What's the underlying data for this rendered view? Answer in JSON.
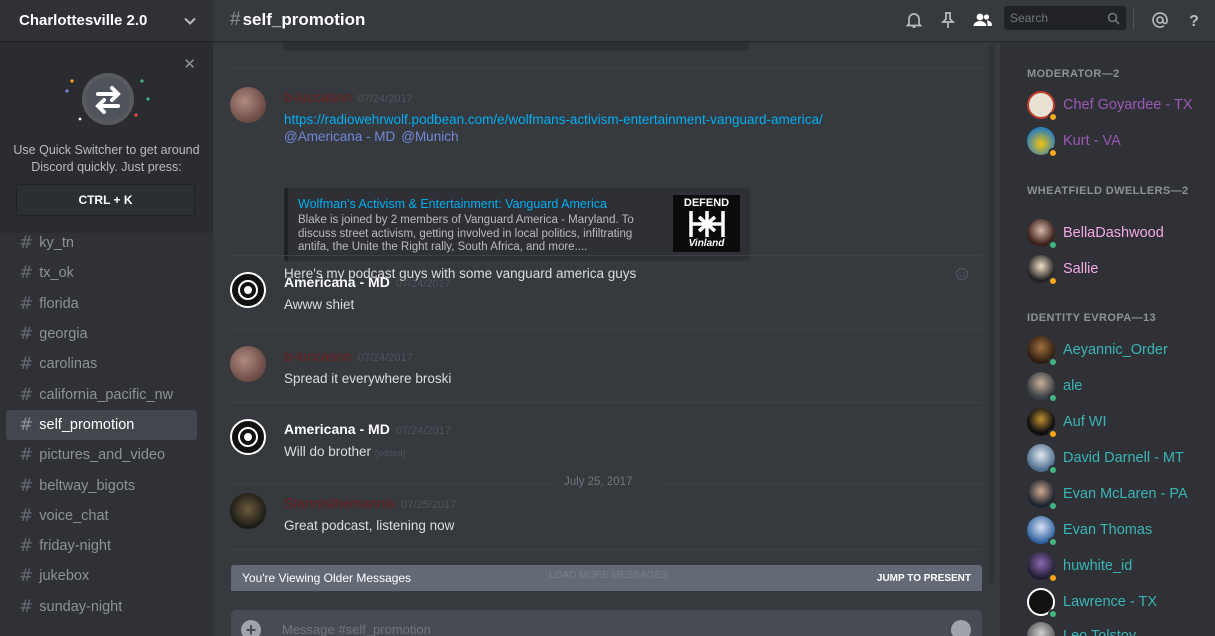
{
  "server": {
    "name": "Charlottesville 2.0"
  },
  "quick_switcher": {
    "line1": "Use Quick Switcher to get around",
    "line2": "Discord quickly. Just press:",
    "key": "CTRL + K"
  },
  "channels": [
    {
      "name": "ky_tn"
    },
    {
      "name": "tx_ok"
    },
    {
      "name": "florida"
    },
    {
      "name": "georgia"
    },
    {
      "name": "carolinas"
    },
    {
      "name": "california_pacific_nw"
    },
    {
      "name": "self_promotion"
    },
    {
      "name": "pictures_and_video"
    },
    {
      "name": "beltway_bigots"
    },
    {
      "name": "voice_chat"
    },
    {
      "name": "friday-night"
    },
    {
      "name": "jukebox"
    },
    {
      "name": "sunday-night"
    }
  ],
  "header": {
    "channel": "self_promotion",
    "search_placeholder": "Search"
  },
  "messages": {
    "m1": {
      "author": "b-luccason",
      "time": "07/24/2017",
      "link": "https://radiowehrwolf.podbean.com/e/wolfmans-activism-entertainment-vanguard-america/",
      "mention1": "@Americana - MD",
      "mention2": "@Munich",
      "embed_title": "Wolfman's Activism & Entertainment: Vanguard America",
      "embed_desc": "Blake is joined by 2 members of Vanguard America - Maryland. To discuss street activism, getting involved in local politics, infiltrating antifa, the Unite the Right rally, South Africa, and more....",
      "embed_img_top": "DEFEND",
      "embed_img_bottom": "Vinland",
      "text": "Here's my podcast guys with some vanguard america guys"
    },
    "m2": {
      "author": "Americana - MD",
      "time": "07/24/2017",
      "text": "Awww shiet"
    },
    "m3": {
      "author": "b-luccason",
      "time": "07/24/2017",
      "text": "Spread it everywhere broski"
    },
    "m4": {
      "author": "Americana - MD",
      "time": "07/24/2017",
      "text": "Will do brother",
      "edited": "(edited)"
    },
    "date_separator": "July 25, 2017",
    "m5": {
      "author": "Stannisthemannis",
      "time": "07/25/2017",
      "text": "Great podcast, listening now"
    }
  },
  "older_bar": {
    "left": "You're Viewing Older Messages",
    "middle": "LOAD MORE MESSAGES",
    "right": "JUMP TO PRESENT"
  },
  "composer": {
    "placeholder": "Message #self_promotion"
  },
  "members": {
    "groups": [
      {
        "title": "MODERATOR—2"
      },
      {
        "title": "WHEATFIELD DWELLERS—2"
      },
      {
        "title": "IDENTITY EVROPA—13"
      }
    ],
    "list": [
      {
        "name": "Chef Goyardee - TX",
        "color": "#9b59b6",
        "status": "#faa61a"
      },
      {
        "name": "Kurt - VA",
        "color": "#9b59b6",
        "status": "#faa61a"
      },
      {
        "name": "BellaDashwood",
        "color": "#f5a9e6",
        "status": "#43b581"
      },
      {
        "name": "Sallie",
        "color": "#f5a9e6",
        "status": "#faa61a"
      },
      {
        "name": "Aeyannic_Order",
        "color": "#3ab5b5",
        "status": "#43b581"
      },
      {
        "name": "ale",
        "color": "#3ab5b5",
        "status": "#43b581"
      },
      {
        "name": "Auf WI",
        "color": "#3ab5b5",
        "status": "#faa61a"
      },
      {
        "name": "David Darnell - MT",
        "color": "#3ab5b5",
        "status": "#43b581"
      },
      {
        "name": "Evan McLaren - PA",
        "color": "#3ab5b5",
        "status": "#43b581"
      },
      {
        "name": "Evan Thomas",
        "color": "#3ab5b5",
        "status": "#43b581"
      },
      {
        "name": "huwhite_id",
        "color": "#3ab5b5",
        "status": "#faa61a"
      },
      {
        "name": "Lawrence - TX",
        "color": "#3ab5b5",
        "status": "#43b581"
      },
      {
        "name": "Leo Tolstoy",
        "color": "#3ab5b5",
        "status": "#43b581"
      }
    ]
  }
}
